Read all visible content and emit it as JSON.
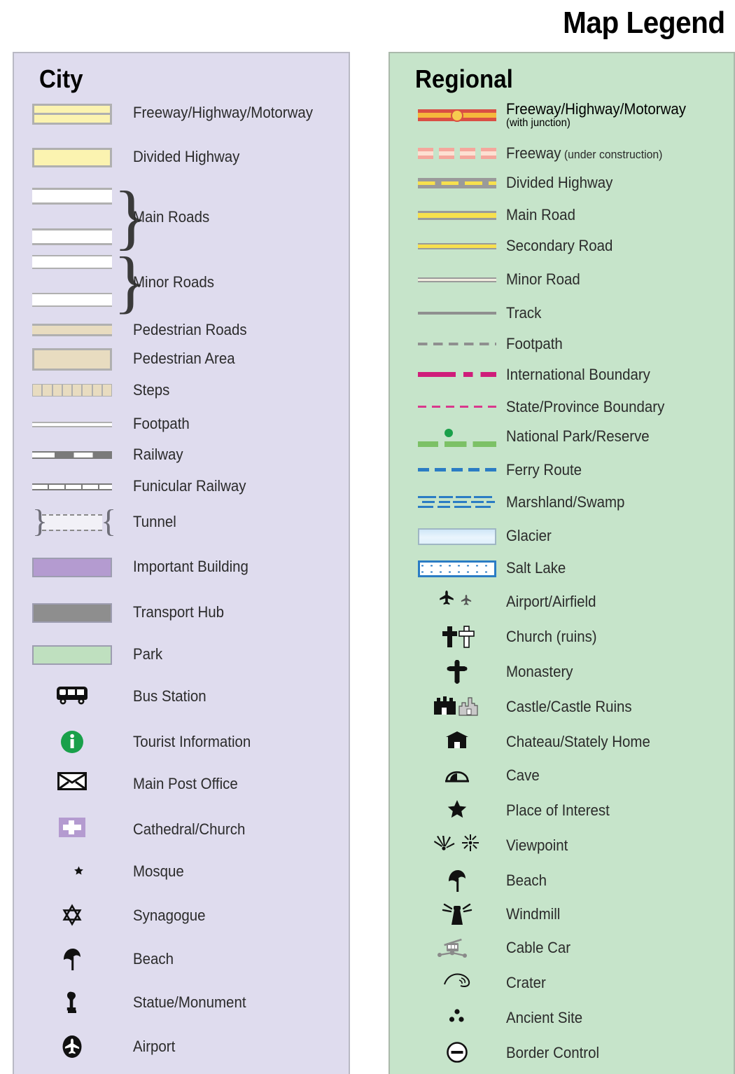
{
  "title": "Map Legend",
  "city": {
    "heading": "City",
    "items": [
      {
        "symbol": "freeway-swatch",
        "label": "Freeway/Highway/Motorway"
      },
      {
        "symbol": "divided-highway-swatch",
        "label": "Divided Highway"
      },
      {
        "symbol": "main-roads-swatch",
        "label": "Main Roads"
      },
      {
        "symbol": "minor-roads-swatch",
        "label": "Minor Roads"
      },
      {
        "symbol": "pedestrian-roads-swatch",
        "label": "Pedestrian Roads"
      },
      {
        "symbol": "pedestrian-area-swatch",
        "label": "Pedestrian Area"
      },
      {
        "symbol": "steps-swatch",
        "label": "Steps"
      },
      {
        "symbol": "footpath-swatch",
        "label": "Footpath"
      },
      {
        "symbol": "railway-swatch",
        "label": "Railway"
      },
      {
        "symbol": "funicular-railway-swatch",
        "label": "Funicular Railway"
      },
      {
        "symbol": "tunnel-swatch",
        "label": "Tunnel"
      },
      {
        "symbol": "important-building-swatch",
        "label": "Important Building"
      },
      {
        "symbol": "transport-hub-swatch",
        "label": "Transport Hub"
      },
      {
        "symbol": "park-swatch",
        "label": "Park"
      },
      {
        "symbol": "bus-icon",
        "label": "Bus Station"
      },
      {
        "symbol": "information-icon",
        "label": "Tourist Information"
      },
      {
        "symbol": "envelope-icon",
        "label": "Main Post Office"
      },
      {
        "symbol": "cross-on-purple-icon",
        "label": "Cathedral/Church"
      },
      {
        "symbol": "star-and-crescent-icon",
        "label": "Mosque"
      },
      {
        "symbol": "star-of-david-icon",
        "label": "Synagogue"
      },
      {
        "symbol": "beach-umbrella-icon",
        "label": "Beach"
      },
      {
        "symbol": "statue-icon",
        "label": "Statue/Monument"
      },
      {
        "symbol": "airplane-in-circle-icon",
        "label": "Airport"
      }
    ]
  },
  "regional": {
    "heading": "Regional",
    "items": [
      {
        "symbol": "freeway-junction-line",
        "label": "Freeway/Highway/Motorway",
        "sub": "(with junction)"
      },
      {
        "symbol": "freeway-under-construction-line",
        "label": "Freeway",
        "suffix": " (under construction)"
      },
      {
        "symbol": "divided-highway-line",
        "label": "Divided Highway"
      },
      {
        "symbol": "main-road-line",
        "label": "Main Road"
      },
      {
        "symbol": "secondary-road-line",
        "label": "Secondary Road"
      },
      {
        "symbol": "minor-road-line",
        "label": "Minor Road"
      },
      {
        "symbol": "track-line",
        "label": "Track"
      },
      {
        "symbol": "footpath-line",
        "label": "Footpath"
      },
      {
        "symbol": "international-boundary-line",
        "label": "International Boundary"
      },
      {
        "symbol": "state-province-boundary-line",
        "label": "State/Province Boundary"
      },
      {
        "symbol": "national-park-line",
        "label": "National Park/Reserve"
      },
      {
        "symbol": "ferry-route-line",
        "label": "Ferry Route"
      },
      {
        "symbol": "marshland-swatch",
        "label": "Marshland/Swamp"
      },
      {
        "symbol": "glacier-swatch",
        "label": "Glacier"
      },
      {
        "symbol": "salt-lake-swatch",
        "label": "Salt Lake"
      },
      {
        "symbol": "airplane-icon",
        "label": "Airport/Airfield"
      },
      {
        "symbol": "cross-icon",
        "label": "Church (ruins)"
      },
      {
        "symbol": "latin-cross-icon",
        "label": "Monastery"
      },
      {
        "symbol": "castle-icon",
        "label": "Castle/Castle Ruins"
      },
      {
        "symbol": "chateau-icon",
        "label": "Chateau/Stately Home"
      },
      {
        "symbol": "cave-icon",
        "label": "Cave"
      },
      {
        "symbol": "star-icon",
        "label": "Place of Interest"
      },
      {
        "symbol": "viewpoint-icon",
        "label": "Viewpoint"
      },
      {
        "symbol": "beach-umbrella-icon",
        "label": "Beach"
      },
      {
        "symbol": "windmill-icon",
        "label": "Windmill"
      },
      {
        "symbol": "cable-car-icon",
        "label": "Cable Car"
      },
      {
        "symbol": "crater-icon",
        "label": "Crater"
      },
      {
        "symbol": "ancient-site-icon",
        "label": "Ancient Site"
      },
      {
        "symbol": "border-control-icon",
        "label": "Border Control"
      }
    ]
  },
  "colors": {
    "city_panel": "#dfdcee",
    "regional_panel": "#c6e4ca",
    "highway_yellow": "#fbf3b0",
    "pedestrian_beige": "#e8dcc0",
    "important_building": "#b49bd0",
    "transport_hub": "#8e8e8e",
    "park_green": "#bfe0bf",
    "freeway_red": "#d94f44",
    "road_yellow": "#f7e04e",
    "boundary_magenta": "#cf1d7a",
    "water_blue": "#2b7cc4",
    "park_line_green": "#7cc166",
    "info_green": "#19a04a"
  }
}
